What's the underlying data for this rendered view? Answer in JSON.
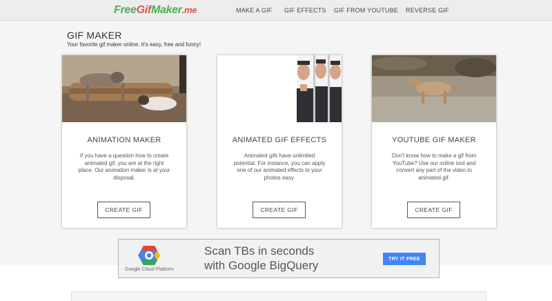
{
  "logo": {
    "part1": "Free",
    "part2": "Gif",
    "part3": "Maker",
    "part4": ".me"
  },
  "nav": [
    {
      "label": "MAKE A GIF"
    },
    {
      "label": "GIF EFFECTS"
    },
    {
      "label": "GIF FROM YOUTUBE"
    },
    {
      "label": "REVERSE GIF"
    }
  ],
  "header": {
    "title": "GIF MAKER",
    "subtitle": "Your favorite gif maker online. It's easy, free and funny!"
  },
  "cards": [
    {
      "title": "ANIMATION MAKER",
      "text": "If you have a question how to create animated gif, you are at the right place. Our animation maker is at your disposal.",
      "button": "CREATE GIF",
      "image": "cats-on-log"
    },
    {
      "title": "ANIMATED GIF EFFECTS",
      "text": "Animated gifs have unlimited potential. For instance, you can apply one of our animated effects to your photos easy.",
      "button": "CREATE GIF",
      "image": "man-faces-strip"
    },
    {
      "title": "YOUTUBE GIF MAKER",
      "text": "Don't know how to make a gif from YouTube? Use our online tool and convert any part of the video to animated gif.",
      "button": "CREATE GIF",
      "image": "lioness-walking"
    }
  ],
  "ad": {
    "headline_line1": "Scan TBs in seconds",
    "headline_line2": "with Google BigQuery",
    "brand": "Google Cloud Platform",
    "cta": "TRY IT FREE",
    "cta_color": "#4285f4"
  },
  "colors": {
    "logo_green": "#4caf50",
    "logo_red": "#d9534f",
    "topbar": "#ededed"
  }
}
